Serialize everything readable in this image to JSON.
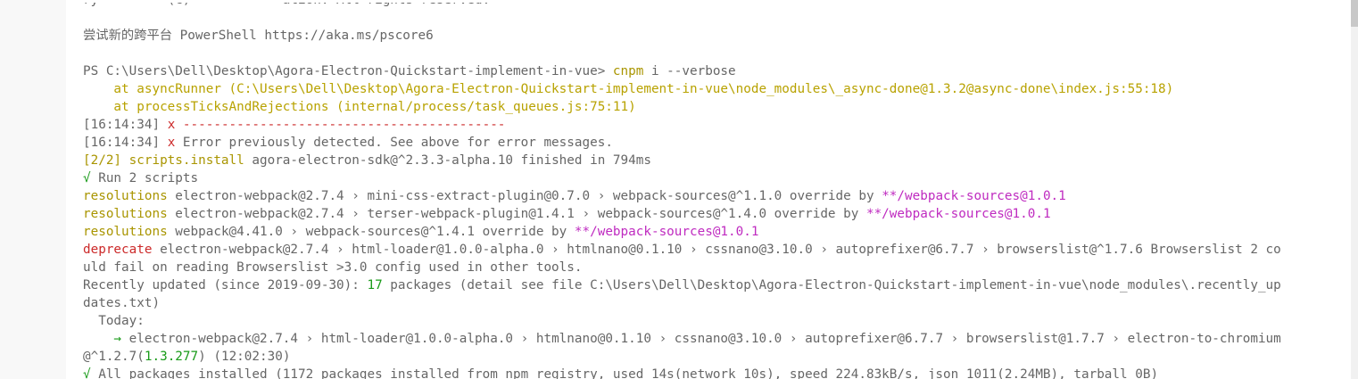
{
  "terminal": {
    "lines": [
      {
        "segments": [
          {
            "text": "ry         (c)            ation. All rights reserved.",
            "color": "gray"
          }
        ]
      },
      {
        "segments": [
          {
            "text": "",
            "color": "gray"
          }
        ]
      },
      {
        "segments": [
          {
            "text": "尝试新的跨平台 PowerShell https://aka.ms/pscore6",
            "color": "gray"
          }
        ]
      },
      {
        "segments": [
          {
            "text": "",
            "color": "gray"
          }
        ]
      },
      {
        "segments": [
          {
            "text": "PS C:\\Users\\Dell\\Desktop\\Agora-Electron-Quickstart-implement-in-vue> ",
            "color": "gray"
          },
          {
            "text": "cnpm",
            "color": "yellowd"
          },
          {
            "text": " i --verbose",
            "color": "gray"
          }
        ]
      },
      {
        "segments": [
          {
            "text": "    at asyncRunner (C:\\Users\\Dell\\Desktop\\Agora-Electron-Quickstart-implement-in-vue\\node_modules\\_async-done@1.3.2@async-done\\index.js:55:18)",
            "color": "yellow"
          }
        ]
      },
      {
        "segments": [
          {
            "text": "    at processTicksAndRejections (internal/process/task_queues.js:75:11)",
            "color": "yellow"
          }
        ]
      },
      {
        "segments": [
          {
            "text": "[16:14:34] ",
            "color": "gray"
          },
          {
            "text": "x ------------------------------------------",
            "color": "red"
          }
        ]
      },
      {
        "segments": [
          {
            "text": "[16:14:34] ",
            "color": "gray"
          },
          {
            "text": "x",
            "color": "red"
          },
          {
            "text": " Error previously detected. See above for error messages.",
            "color": "gray"
          }
        ]
      },
      {
        "segments": [
          {
            "text": "[2/2] scripts.install ",
            "color": "yellowd"
          },
          {
            "text": "agora-electron-sdk@^2.3.3-alpha.10 finished in 794ms",
            "color": "gray"
          }
        ]
      },
      {
        "segments": [
          {
            "text": "√ ",
            "color": "green"
          },
          {
            "text": "Run 2 scripts",
            "color": "gray"
          }
        ]
      },
      {
        "segments": [
          {
            "text": "resolutions ",
            "color": "yellowd"
          },
          {
            "text": "electron-webpack@2.7.4 › mini-css-extract-plugin@0.7.0 › webpack-sources@^1.1.0 override by ",
            "color": "gray"
          },
          {
            "text": "**/webpack-sources@1.0.1",
            "color": "magenta"
          }
        ]
      },
      {
        "segments": [
          {
            "text": "resolutions ",
            "color": "yellowd"
          },
          {
            "text": "electron-webpack@2.7.4 › terser-webpack-plugin@1.4.1 › webpack-sources@^1.4.0 override by ",
            "color": "gray"
          },
          {
            "text": "**/webpack-sources@1.0.1",
            "color": "magenta"
          }
        ]
      },
      {
        "segments": [
          {
            "text": "resolutions ",
            "color": "yellowd"
          },
          {
            "text": "webpack@4.41.0 › webpack-sources@^1.4.1 override by ",
            "color": "gray"
          },
          {
            "text": "**/webpack-sources@1.0.1",
            "color": "magenta"
          }
        ]
      },
      {
        "segments": [
          {
            "text": "deprecate ",
            "color": "red"
          },
          {
            "text": "electron-webpack@2.7.4 › html-loader@1.0.0-alpha.0 › htmlnano@0.1.10 › cssnano@3.10.0 › autoprefixer@6.7.7 › browserslist@^1.7.6 Browserslist 2 co",
            "color": "gray"
          }
        ]
      },
      {
        "segments": [
          {
            "text": "uld fail on reading Browserslist >3.0 config used in other tools.",
            "color": "gray"
          }
        ]
      },
      {
        "segments": [
          {
            "text": "Recently updated (since 2019-09-30): ",
            "color": "gray"
          },
          {
            "text": "17",
            "color": "green"
          },
          {
            "text": " packages (detail see file C:\\Users\\Dell\\Desktop\\Agora-Electron-Quickstart-implement-in-vue\\node_modules\\.recently_up",
            "color": "gray"
          }
        ]
      },
      {
        "segments": [
          {
            "text": "dates.txt)",
            "color": "gray"
          }
        ]
      },
      {
        "segments": [
          {
            "text": "  Today:",
            "color": "gray"
          }
        ]
      },
      {
        "segments": [
          {
            "text": "    → ",
            "color": "green"
          },
          {
            "text": "electron-webpack@2.7.4 › html-loader@1.0.0-alpha.0 › htmlnano@0.1.10 › cssnano@3.10.0 › autoprefixer@6.7.7 › browserslist@1.7.7 › electron-to-chromium",
            "color": "gray"
          }
        ]
      },
      {
        "segments": [
          {
            "text": "@^1.2.7(",
            "color": "gray"
          },
          {
            "text": "1.3.277",
            "color": "green"
          },
          {
            "text": ") (12:02:30)",
            "color": "gray"
          }
        ]
      },
      {
        "segments": [
          {
            "text": "√ ",
            "color": "green"
          },
          {
            "text": "All packages installed (1172 packages installed from npm registry, used 14s(network 10s), speed 224.83kB/s, json 1011(2.24MB), tarball 0B)",
            "color": "gray"
          }
        ]
      }
    ]
  }
}
